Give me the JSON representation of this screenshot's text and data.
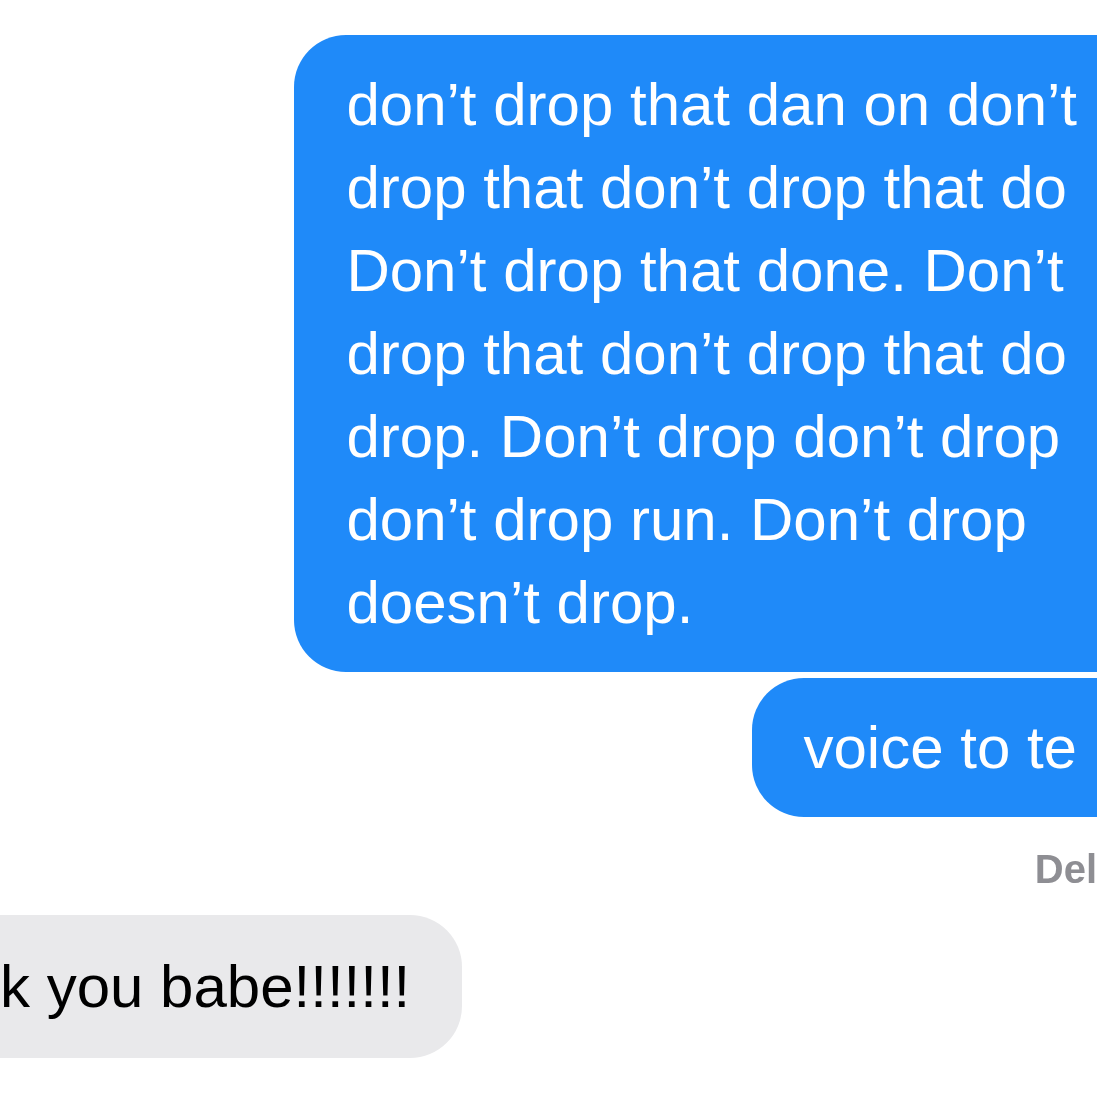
{
  "messages": [
    {
      "kind": "sent",
      "lines": [
        "don’t drop that dan on don’t",
        "drop that don’t drop that do",
        "Don’t drop that done. Don’t",
        "drop that don’t drop that do",
        "drop. Don’t drop don’t drop",
        "don’t drop run. Don’t drop",
        "doesn’t drop."
      ]
    },
    {
      "kind": "sent",
      "lines": [
        "voice to te"
      ]
    },
    {
      "kind": "status",
      "text": "Del"
    },
    {
      "kind": "received",
      "lines": [
        "k you babe!!!!!!!"
      ]
    }
  ]
}
